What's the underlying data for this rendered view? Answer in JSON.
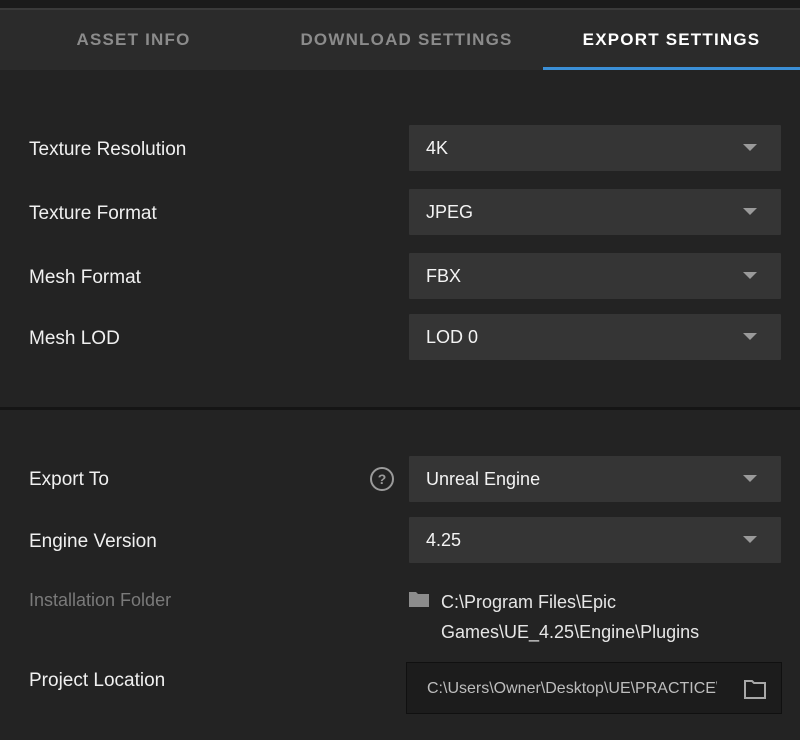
{
  "tabs": [
    {
      "label": "ASSET INFO",
      "active": false
    },
    {
      "label": "DOWNLOAD SETTINGS",
      "active": false
    },
    {
      "label": "EXPORT SETTINGS",
      "active": true
    }
  ],
  "accent_color": "#3b8fd6",
  "texture": {
    "resolution": {
      "label": "Texture Resolution",
      "value": "4K"
    },
    "format": {
      "label": "Texture Format",
      "value": "JPEG"
    }
  },
  "mesh": {
    "format": {
      "label": "Mesh Format",
      "value": "FBX"
    },
    "lod": {
      "label": "Mesh LOD",
      "value": "LOD 0"
    }
  },
  "export": {
    "export_to": {
      "label": "Export To",
      "value": "Unreal Engine",
      "help_icon": "question-circle-icon"
    },
    "engine_version": {
      "label": "Engine Version",
      "value": "4.25"
    },
    "installation_folder": {
      "label": "Installation Folder",
      "path_line1": "C:\\Program Files\\Epic",
      "path_line2": "Games\\UE_4.25\\Engine\\Plugins",
      "icon": "folder-icon"
    },
    "project_location": {
      "label": "Project Location",
      "value": "C:\\Users\\Owner\\Desktop\\UE\\PRACTICE\\",
      "browse_icon": "folder-outline-icon"
    }
  }
}
